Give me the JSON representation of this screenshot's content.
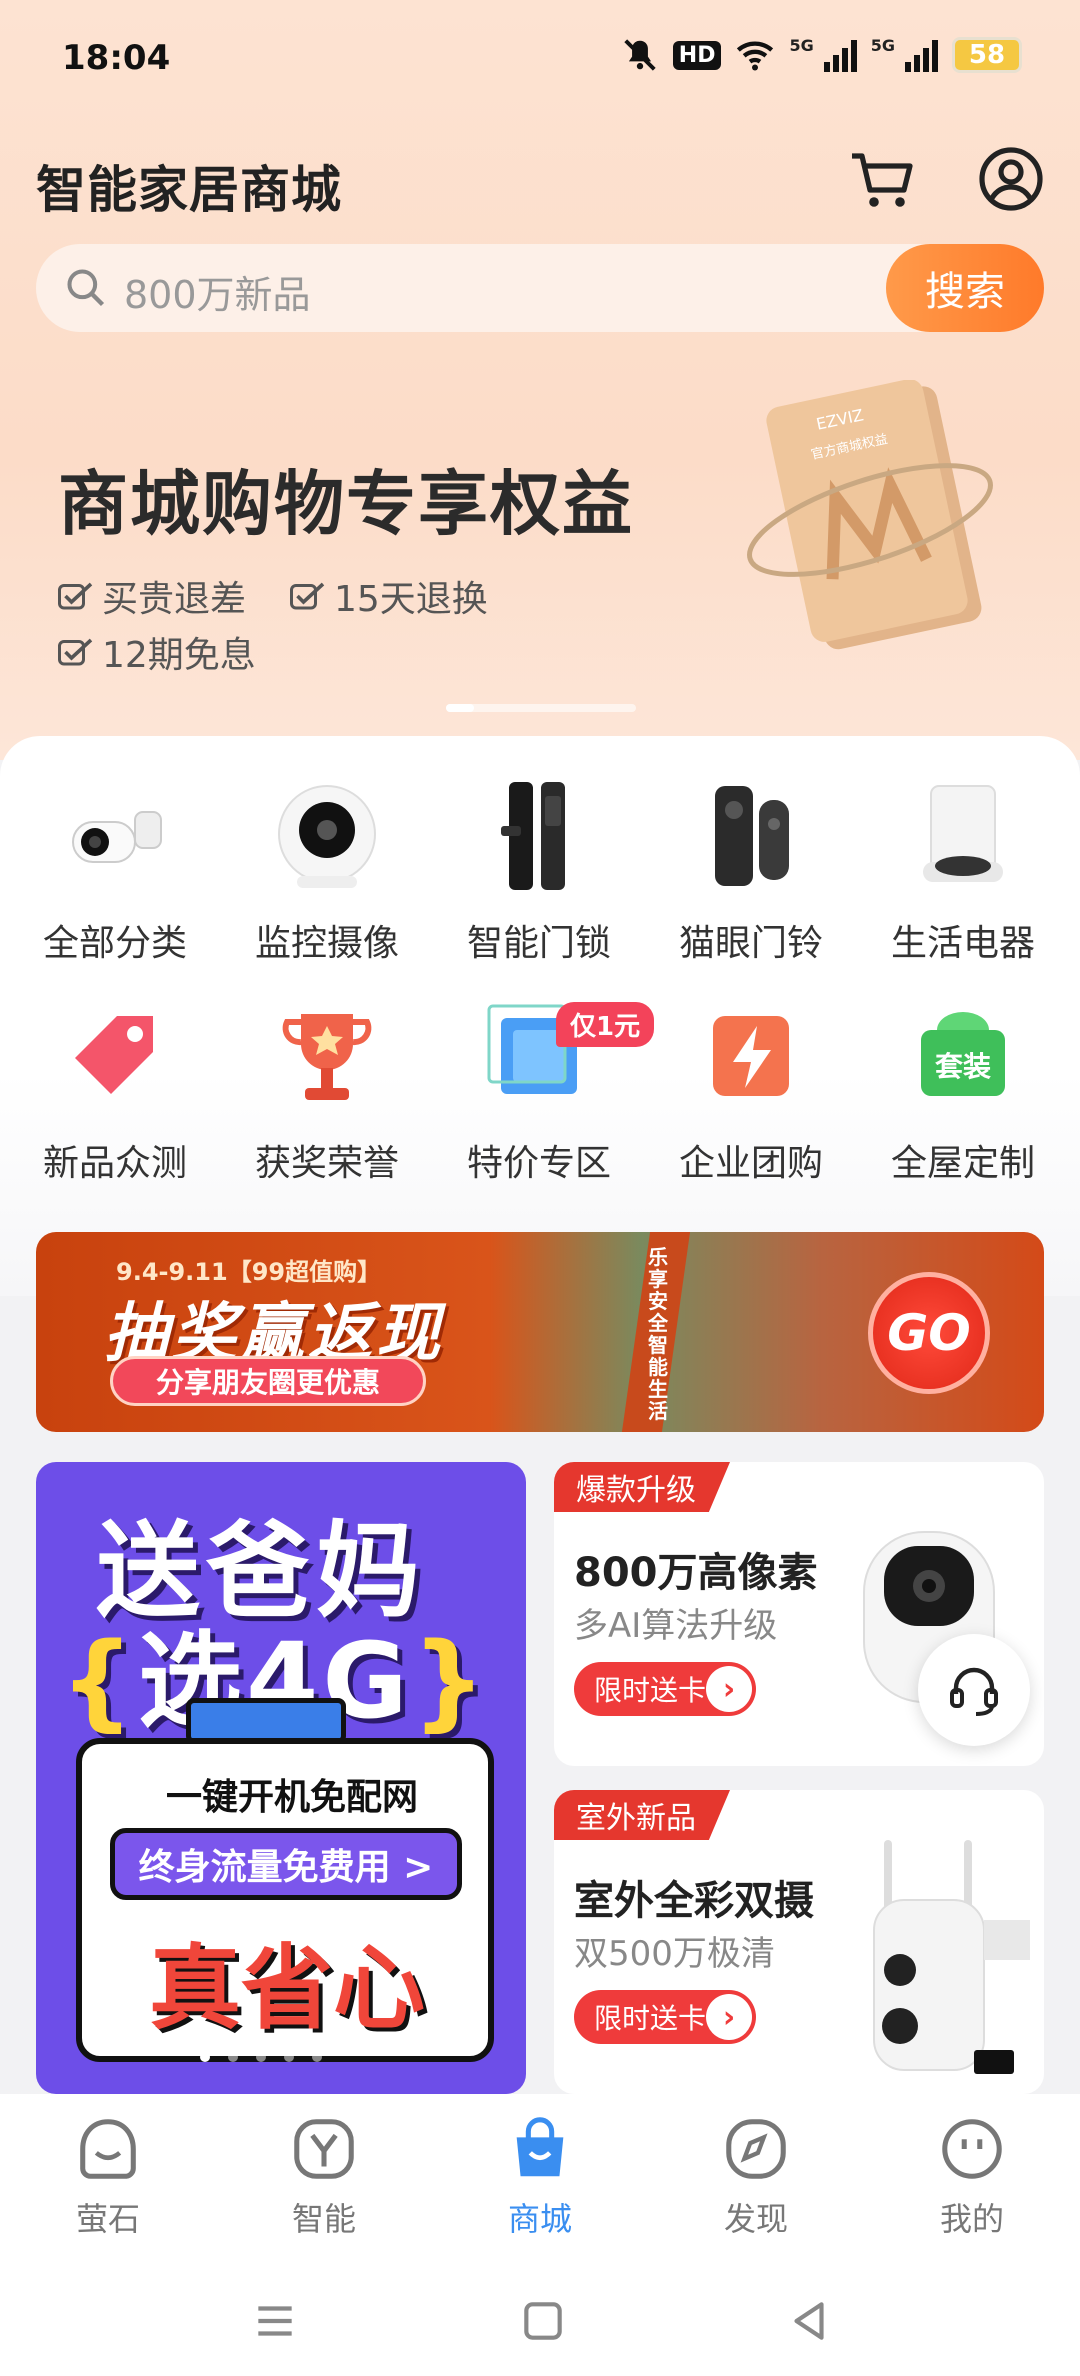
{
  "status_bar": {
    "time": "18:04",
    "battery": "58",
    "network_1": "5G",
    "network_2": "5G",
    "hd": "HD"
  },
  "header": {
    "title": "智能家居商城"
  },
  "search": {
    "placeholder": "800万新品",
    "button": "搜索"
  },
  "banner": {
    "title": "商城购物专享权益",
    "perks": [
      "买贵退差",
      "15天退换",
      "12期免息"
    ],
    "card_brand": "EZVIZ",
    "card_text": "官方商城权益"
  },
  "categories": [
    {
      "label": "全部分类",
      "icon": "camera-bullet-icon"
    },
    {
      "label": "监控摄像",
      "icon": "camera-dome-icon"
    },
    {
      "label": "智能门锁",
      "icon": "door-lock-icon"
    },
    {
      "label": "猫眼门铃",
      "icon": "doorbell-icon"
    },
    {
      "label": "生活电器",
      "icon": "robot-vacuum-icon"
    },
    {
      "label": "新品众测",
      "icon": "tag-icon"
    },
    {
      "label": "获奖荣誉",
      "icon": "trophy-icon"
    },
    {
      "label": "特价专区",
      "icon": "cube-icon",
      "badge": "仅1元"
    },
    {
      "label": "企业团购",
      "icon": "lightning-icon"
    },
    {
      "label": "全屋定制",
      "icon": "package-icon",
      "badge_text": "套装"
    }
  ],
  "lottery": {
    "date": "9.4-9.11【99超值购】",
    "title": "抽奖赢返现",
    "share": "分享朋友圈更优惠",
    "go": "GO",
    "vertical_text": "乐享安全智能生活"
  },
  "promo": {
    "line1": "送爸妈",
    "line2": "选4G",
    "brace_left": "{",
    "brace_right": "}",
    "one_key": "一键开机免配网",
    "free": "终身流量免费用 >",
    "save": "真省心"
  },
  "products": [
    {
      "tag": "爆款升级",
      "title": "800万高像素",
      "subtitle": "多AI算法升级",
      "cta": "限时送卡"
    },
    {
      "tag": "室外新品",
      "title": "室外全彩双摄",
      "subtitle": "双500万极清",
      "cta": "限时送卡"
    }
  ],
  "tabs": [
    {
      "label": "萤石",
      "icon": "home-face-icon"
    },
    {
      "label": "智能",
      "icon": "smart-y-icon"
    },
    {
      "label": "商城",
      "icon": "shopping-bag-icon",
      "active": true
    },
    {
      "label": "发现",
      "icon": "compass-icon"
    },
    {
      "label": "我的",
      "icon": "profile-face-icon"
    }
  ],
  "colors": {
    "accent": "#ff8a3a",
    "active_tab": "#3a8ef0",
    "promo_bg": "#6d4ee8",
    "tag_red": "#e5372e"
  }
}
